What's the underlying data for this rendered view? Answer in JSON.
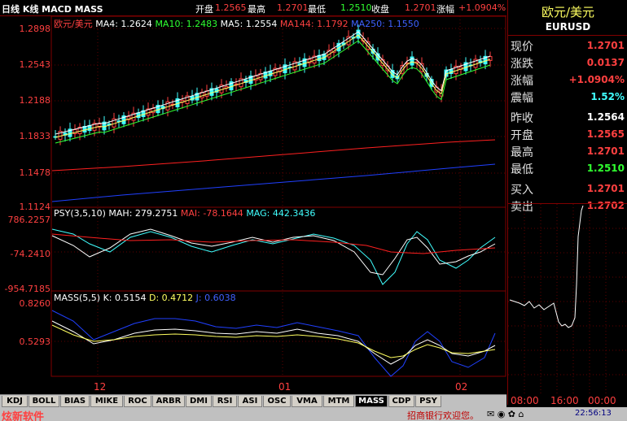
{
  "header": {
    "title": "日线 K线 MACD MASS",
    "open_label": "开盘",
    "open_value": "1.2565",
    "high_label": "最高",
    "high_value": "1.2701",
    "low_label": "最低",
    "low_value": "1.2510",
    "close_label": "收盘",
    "close_value": "1.2701",
    "change_label": "涨幅",
    "change_value": "+1.0904%"
  },
  "price_panel": {
    "symbol_label": "欧元/美元",
    "ma4": "MA4: 1.2624",
    "ma10": "MA10: 1.2483",
    "ma5": "MA5: 1.2554",
    "ma144": "MA144: 1.1792",
    "ma250": "MA250: 1.1550",
    "y_ticks": [
      "1.2898",
      "1.2543",
      "1.2188",
      "1.1833",
      "1.1478",
      "1.1124"
    ]
  },
  "psy_panel": {
    "title": "PSY(3,5,10)",
    "mah": "MAH: 279.2751",
    "mai": "MAI: -78.1644",
    "mag": "MAG: 442.3436",
    "y_ticks": [
      "786.2257",
      "-74.2410",
      "-954.7185"
    ]
  },
  "mass_panel": {
    "title": "MASS(5,5)",
    "k": "K: 0.5154",
    "d": "D: 0.4712",
    "j": "J: 0.6038",
    "y_ticks": [
      "0.8260",
      "0.5293"
    ]
  },
  "x_axis": {
    "labels": [
      "12",
      "01",
      "02"
    ]
  },
  "sidebar": {
    "title": "欧元/美元",
    "code": "EURUSD",
    "rows": [
      {
        "label": "现价",
        "value": "1.2701"
      },
      {
        "label": "涨跌",
        "value": "0.0137"
      },
      {
        "label": "涨幅",
        "value": "+1.0904%"
      },
      {
        "label": "震幅",
        "value": "1.52%"
      },
      {
        "label": "昨收",
        "value": "1.2564"
      },
      {
        "label": "开盘",
        "value": "1.2565"
      },
      {
        "label": "最高",
        "value": "1.2701"
      },
      {
        "label": "最低",
        "value": "1.2510"
      },
      {
        "label": "买入",
        "value": "1.2701"
      },
      {
        "label": "卖出",
        "value": "1.2702"
      }
    ],
    "time_labels": [
      "08:00",
      "16:00",
      "00:00"
    ]
  },
  "tabs": [
    "KDJ",
    "BOLL",
    "BIAS",
    "MIKE",
    "ROC",
    "ARBR",
    "DMI",
    "RSI",
    "ASI",
    "OSC",
    "VMA",
    "MTM",
    "MASS",
    "CDP",
    "PSY"
  ],
  "active_tab": "MASS",
  "status": {
    "brand": "炫新软件",
    "marquee": "招商银行欢迎您。",
    "clock": "22:56:13"
  },
  "colors": {
    "up": "#ff4040",
    "down": "#40ffff",
    "border": "#800000",
    "ma4": "#ffffff",
    "ma10": "#30ff30",
    "ma144": "#ff2020",
    "ma250": "#2040ff"
  }
}
